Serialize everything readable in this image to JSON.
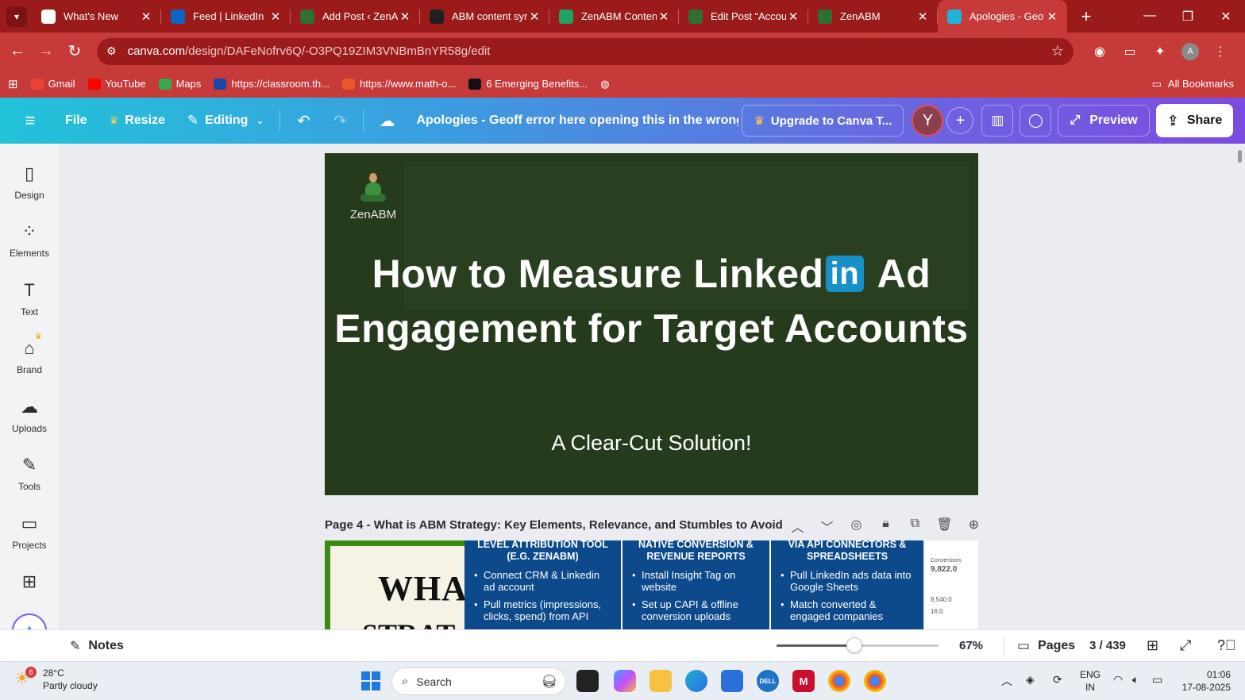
{
  "browser": {
    "tabs": [
      {
        "title": "What's New",
        "favicon": "chrome-icon",
        "color": "#ffffff",
        "active": false
      },
      {
        "title": "Feed | LinkedIn",
        "favicon": "linkedin-icon",
        "color": "#0a66c2",
        "active": false
      },
      {
        "title": "Add Post ‹ ZenAI",
        "favicon": "zenabm-icon",
        "color": "#2f6f2f",
        "active": false
      },
      {
        "title": "ABM content syn",
        "favicon": "openai-icon",
        "color": "#202020",
        "active": false
      },
      {
        "title": "ZenABM Conten",
        "favicon": "sheets-icon",
        "color": "#1ea362",
        "active": false
      },
      {
        "title": "Edit Post “Accou",
        "favicon": "zenabm-icon",
        "color": "#2f6f2f",
        "active": false
      },
      {
        "title": "ZenABM",
        "favicon": "zenabm-icon",
        "color": "#2f6f2f",
        "active": false
      },
      {
        "title": "Apologies - Geo",
        "favicon": "canva-icon",
        "color": "#1fb5d9",
        "active": true
      }
    ],
    "url_host": "canva.com",
    "url_path": "/design/DAFeNofrv6Q/-O3PQ19ZIM3VNBmBnYR58g/edit",
    "profile_initial": "A",
    "bookmarks": [
      {
        "label": "Gmail",
        "icon": "gmail-icon",
        "color": "#ea4335"
      },
      {
        "label": "YouTube",
        "icon": "youtube-icon",
        "color": "#ff0000"
      },
      {
        "label": "Maps",
        "icon": "maps-icon",
        "color": "#34a853"
      },
      {
        "label": "https://classroom.th...",
        "icon": "classroom-icon",
        "color": "#1a46a8"
      },
      {
        "label": "https://www.math-o...",
        "icon": "math-icon",
        "color": "#e8562a"
      },
      {
        "label": "6 Emerging Benefits...",
        "icon": "article-icon",
        "color": "#111111"
      }
    ],
    "all_bookmarks": "All Bookmarks"
  },
  "canva": {
    "file": "File",
    "resize": "Resize",
    "editing": "Editing",
    "doc_title": "Apologies - Geoff error here opening this in the wrong ...",
    "upgrade": "Upgrade to Canva T...",
    "user_initial": "Y",
    "preview": "Preview",
    "share": "Share"
  },
  "sidebar": {
    "items": [
      {
        "label": "Design",
        "icon": "design-icon"
      },
      {
        "label": "Elements",
        "icon": "elements-icon"
      },
      {
        "label": "Text",
        "icon": "text-icon"
      },
      {
        "label": "Brand",
        "icon": "brand-icon"
      },
      {
        "label": "Uploads",
        "icon": "uploads-icon"
      },
      {
        "label": "Tools",
        "icon": "tools-icon"
      },
      {
        "label": "Projects",
        "icon": "projects-icon"
      },
      {
        "label": "",
        "icon": "apps-icon"
      }
    ]
  },
  "slide3": {
    "logo_text": "ZenABM",
    "title_part1": "How to Measure Linked",
    "title_in": "in",
    "title_part2": " Ad Engagement for Target Accounts",
    "subtitle": "A Clear-Cut Solution!"
  },
  "page4": {
    "label": "Page 4 - What is ABM Strategy: Key Elements, Relevance, and Stumbles to Avoid",
    "big_text": "WHA",
    "big_text2": "STRAT",
    "columns": [
      {
        "header": "LEVEL ATTRIBUTION TOOL (E.G. ZENABM)",
        "bullets": [
          "Connect CRM & Linkedin ad account",
          "Pull metrics (impressions, clicks, spend) from API"
        ]
      },
      {
        "header": "NATIVE CONVERSION & REVENUE REPORTS",
        "bullets": [
          "Install Insight Tag on website",
          "Set up CAPI & offline conversion uploads"
        ]
      },
      {
        "header": "VIA API CONNECTORS & SPREADSHEETS",
        "bullets": [
          "Pull LinkedIn ads data into Google Sheets",
          "Match converted & engaged companies"
        ]
      }
    ],
    "mini_label": "Conversions",
    "mini_value": "9,822.0",
    "mini_v2": "8,540.0",
    "mini_v3": "16.0"
  },
  "bottom": {
    "notes": "Notes",
    "zoom": "67%",
    "zoom_fraction": 0.48,
    "pages": "Pages",
    "page_count": "3 / 439"
  },
  "taskbar": {
    "temperature": "28°C",
    "weather": "Partly cloudy",
    "weather_badge": "8",
    "search": "Search",
    "lang1": "ENG",
    "lang2": "IN",
    "time": "01:06",
    "date": "17-08-2025"
  }
}
